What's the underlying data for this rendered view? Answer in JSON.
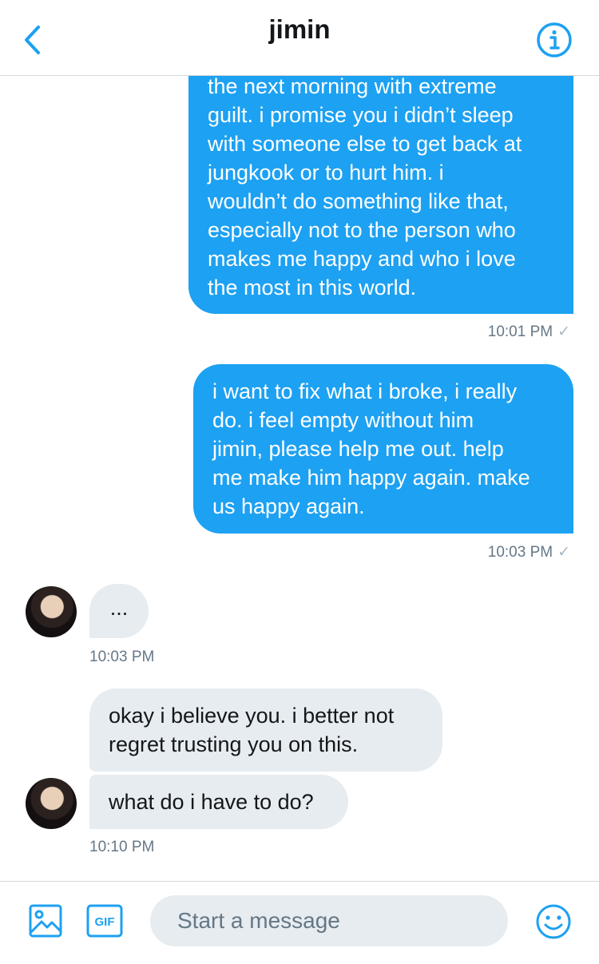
{
  "header": {
    "title": "jimin"
  },
  "icons": {
    "back": "chevron-left-icon",
    "info": "info-icon",
    "media": "image-icon",
    "gif": "gif-icon",
    "emoji": "smiley-icon"
  },
  "colors": {
    "accent": "#1da1f2",
    "incoming_bubble": "#e6ecf0",
    "timestamp": "#657786"
  },
  "messages": [
    {
      "direction": "outgoing",
      "text": "the next morning with extreme\nguilt. i promise you i didn’t sleep\nwith someone else to get back at\njungkook or to hurt him. i\nwouldn’t do something like that,\nespecially not to the person who\nmakes me happy and who i love\nthe most in this world.",
      "time": "10:01 PM",
      "read_mark": "✓"
    },
    {
      "direction": "outgoing",
      "text": "i want to fix what i broke, i really\ndo. i feel empty without him\njimin, please help me out. help\nme make him happy again. make\nus happy again.",
      "time": "10:03 PM",
      "read_mark": "✓"
    },
    {
      "direction": "incoming",
      "text": "...",
      "time": "10:03 PM"
    },
    {
      "direction": "incoming",
      "text": "okay i believe you. i better not\nregret trusting you on this."
    },
    {
      "direction": "incoming",
      "text": "what do i have to do?",
      "time": "10:10 PM"
    }
  ],
  "composer": {
    "gif_label": "GIF",
    "placeholder": "Start a message"
  }
}
